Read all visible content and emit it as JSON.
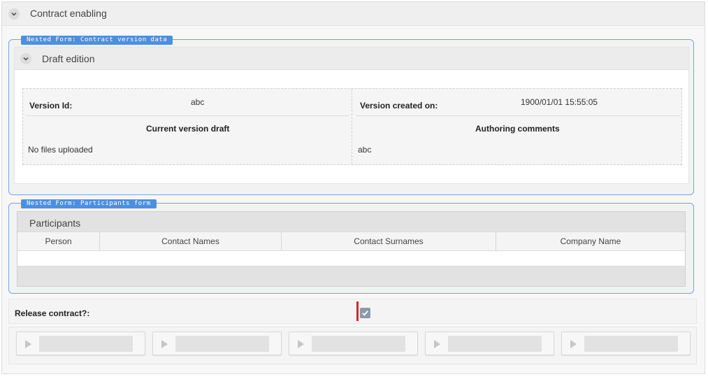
{
  "section": {
    "title": "Contract enabling"
  },
  "contract_version_form": {
    "tag": "Nested Form: Contract version data",
    "panel_title": "Draft edition",
    "version_id_label": "Version Id:",
    "version_id_value": "abc",
    "created_on_label": "Version created on:",
    "created_on_value": "1900/01/01 15:55:05",
    "current_draft_label": "Current version draft",
    "current_draft_value": "No files uploaded",
    "authoring_comments_label": "Authoring comments",
    "authoring_comments_value": "abc"
  },
  "participants_form": {
    "tag": "Nested Form: Participants form",
    "grid_title": "Participants",
    "columns": [
      "Person",
      "Contact Names",
      "Contact Surnames",
      "Company Name"
    ]
  },
  "release": {
    "label": "Release contract?:",
    "checked": true
  },
  "colors": {
    "accent": "#4a90e2",
    "required_marker": "#d9252b"
  },
  "action_buttons": [
    {
      "icon": "play-icon"
    },
    {
      "icon": "play-icon"
    },
    {
      "icon": "play-icon"
    },
    {
      "icon": "play-icon"
    },
    {
      "icon": "play-icon"
    }
  ]
}
